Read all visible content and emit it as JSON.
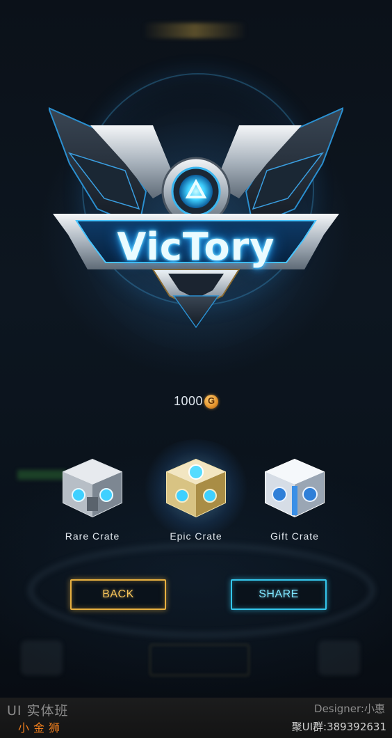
{
  "emblem": {
    "title": "VicTory"
  },
  "reward": {
    "amount": "1000",
    "currency_icon": "gold-coin-icon"
  },
  "crates": [
    {
      "label": "Rare Crate",
      "icon": "rare-crate-icon",
      "tint": "#c8ccd2"
    },
    {
      "label": "Epic Crate",
      "icon": "epic-crate-icon",
      "tint": "#e6cf8a"
    },
    {
      "label": "Gift Crate",
      "icon": "gift-crate-icon",
      "tint": "#dfe6ef"
    }
  ],
  "buttons": {
    "back_label": "BACK",
    "share_label": "SHARE"
  },
  "colors": {
    "back_accent": "#e8b040",
    "share_accent": "#34c6ec",
    "title_glow": "#2fb7ff"
  },
  "footer": {
    "left_line1": "UI 实体班",
    "left_line2": "小金狮",
    "right_line1": "Designer:小惠",
    "right_line2": "聚UI群:389392631"
  }
}
